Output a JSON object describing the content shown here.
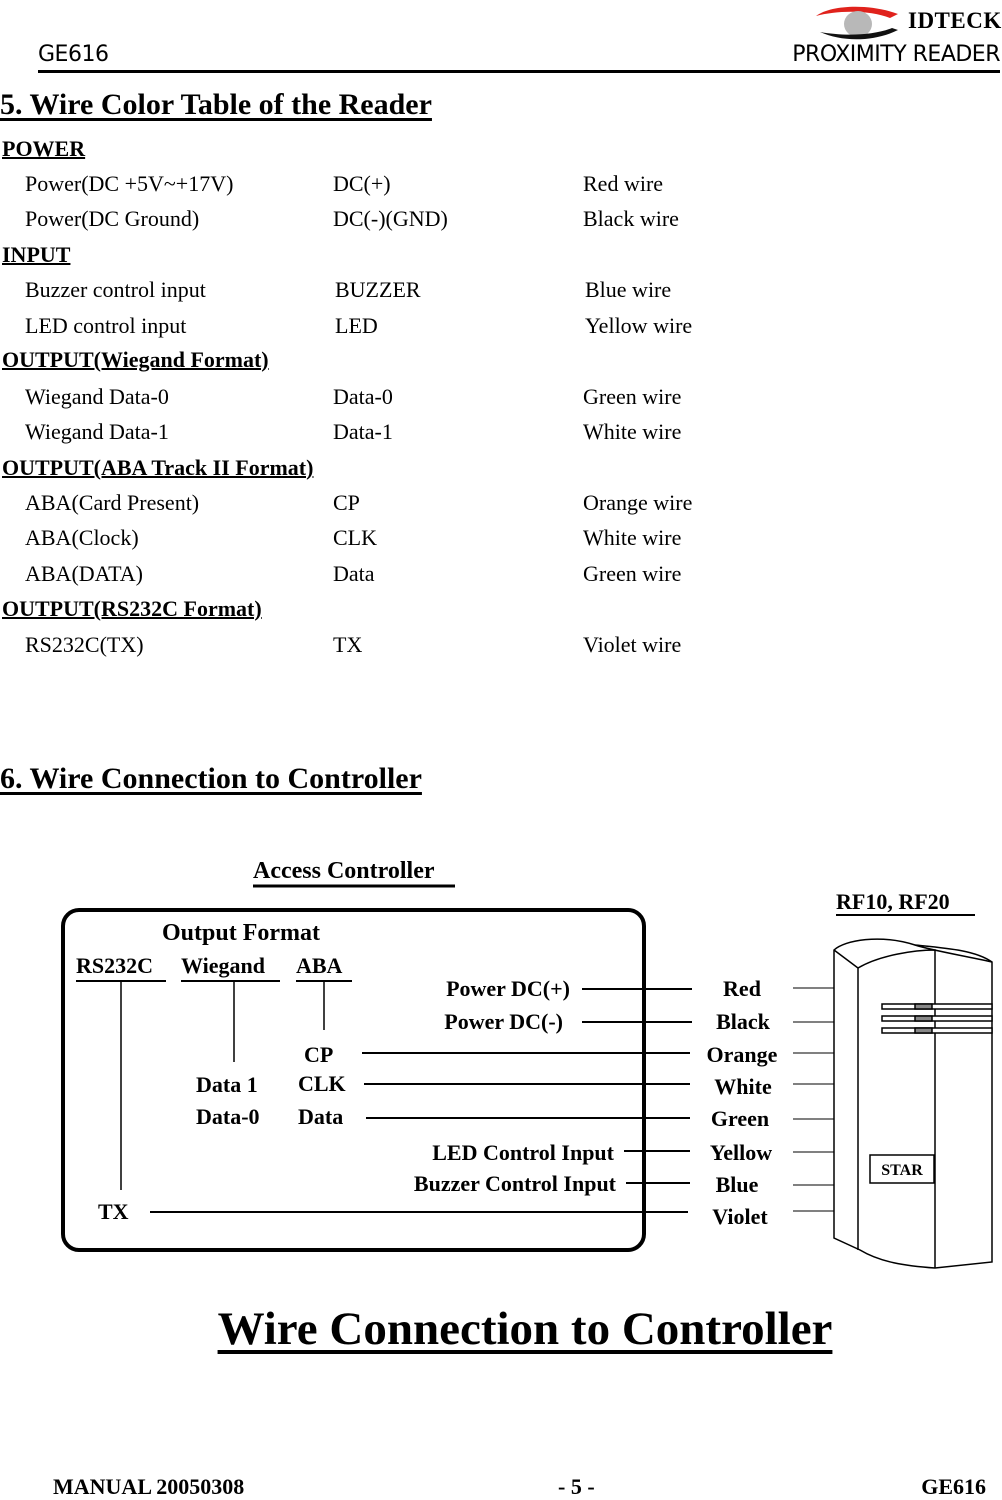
{
  "header": {
    "logo_text": "IDTECK",
    "left": "GE616",
    "right": "PROXIMITY READER"
  },
  "section5": {
    "title": "5. Wire Color Table of the Reader",
    "groups": [
      {
        "title": "POWER",
        "rows": [
          {
            "function": "Power(DC +5V~+17V)",
            "signal": "DC(+)",
            "wire": "Red wire"
          },
          {
            "function": "Power(DC Ground)",
            "signal": "DC(-)(GND)",
            "wire": "Black wire"
          }
        ]
      },
      {
        "title": "INPUT",
        "rows": [
          {
            "function": "Buzzer control input",
            "signal": "BUZZER",
            "wire": "Blue wire"
          },
          {
            "function": "LED control input",
            "signal": "LED",
            "wire": "Yellow wire"
          }
        ]
      },
      {
        "title": "OUTPUT(Wiegand Format)",
        "rows": [
          {
            "function": "Wiegand Data-0",
            "signal": "Data-0",
            "wire": "Green wire"
          },
          {
            "function": "Wiegand Data-1",
            "signal": "Data-1",
            "wire": "White wire"
          }
        ]
      },
      {
        "title": "OUTPUT(ABA Track II Format)",
        "rows": [
          {
            "function": "ABA(Card Present)",
            "signal": "CP",
            "wire": "Orange wire"
          },
          {
            "function": "ABA(Clock)",
            "signal": "CLK",
            "wire": "White wire"
          },
          {
            "function": "ABA(DATA)",
            "signal": "Data",
            "wire": "Green wire"
          }
        ]
      },
      {
        "title": "OUTPUT(RS232C Format)",
        "rows": [
          {
            "function": "RS232C(TX)",
            "signal": "TX",
            "wire": "Violet wire"
          }
        ]
      }
    ]
  },
  "section6": {
    "title": "6. Wire Connection to Controller"
  },
  "diagram": {
    "controller_label": "Access Controller",
    "output_format_label": "Output Format",
    "formats": [
      "RS232C",
      "Wiegand",
      "ABA"
    ],
    "reader_label": "RF10, RF20",
    "reader_badge": "STAR",
    "controller_terminals": {
      "power_plus": "Power DC(+)",
      "power_minus": "Power DC(-)",
      "cp": "CP",
      "clk": "CLK",
      "data": "Data",
      "data1": "Data 1",
      "data0": "Data-0",
      "led": "LED Control Input",
      "buzzer": "Buzzer Control Input",
      "tx": "TX"
    },
    "wires": [
      "Red",
      "Black",
      "Orange",
      "White",
      "Green",
      "Yellow",
      "Blue",
      "Violet"
    ]
  },
  "caption": "Wire Connection to Controller",
  "footer": {
    "left": "MANUAL 20050308",
    "center": "- 5 -",
    "right": "GE616"
  }
}
